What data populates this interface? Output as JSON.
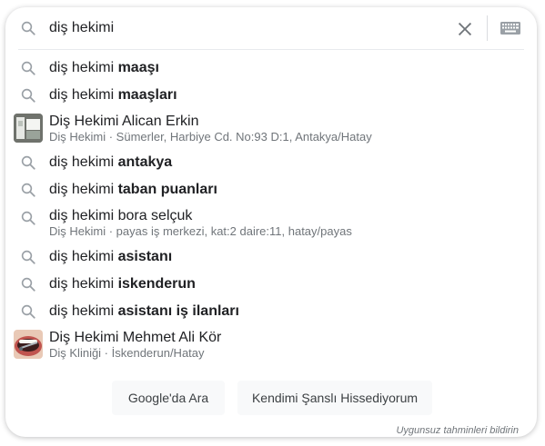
{
  "search": {
    "query": "diş hekimi",
    "icons": {
      "search": "search-icon",
      "clear": "close-icon",
      "keyboard": "keyboard-icon"
    }
  },
  "suggestions": [
    {
      "prefix": "diş hekimi ",
      "bold": "maaşı"
    },
    {
      "prefix": "diş hekimi ",
      "bold": "maaşları"
    },
    {
      "title": "Diş Hekimi Alican Erkin",
      "subtitle": "Diş Hekimi · Sümerler, Harbiye Cd. No:93 D:1, Antakya/Hatay"
    },
    {
      "prefix": "diş hekimi ",
      "bold": "antakya"
    },
    {
      "prefix": "diş hekimi ",
      "bold": "taban puanları"
    },
    {
      "title": "diş hekimi bora selçuk",
      "subtitle": "Diş Hekimi · payas iş merkezi, kat:2 daire:11, hatay/payas"
    },
    {
      "prefix": "diş hekimi ",
      "bold": "asistanı"
    },
    {
      "prefix": "diş hekimi ",
      "bold": "iskenderun"
    },
    {
      "prefix": "diş hekimi ",
      "bold": "asistanı iş ilanları"
    },
    {
      "title": "Diş Hekimi Mehmet Ali Kör",
      "subtitle": "Diş Kliniği · İskenderun/Hatay"
    }
  ],
  "buttons": {
    "search": "Google'da Ara",
    "lucky": "Kendimi Şanslı Hissediyorum"
  },
  "report_link": "Uygunsuz tahminleri bildirin",
  "colors": {
    "text": "#202124",
    "muted": "#70757a",
    "icon": "#9aa0a6",
    "button_bg": "#f8f9fa"
  }
}
